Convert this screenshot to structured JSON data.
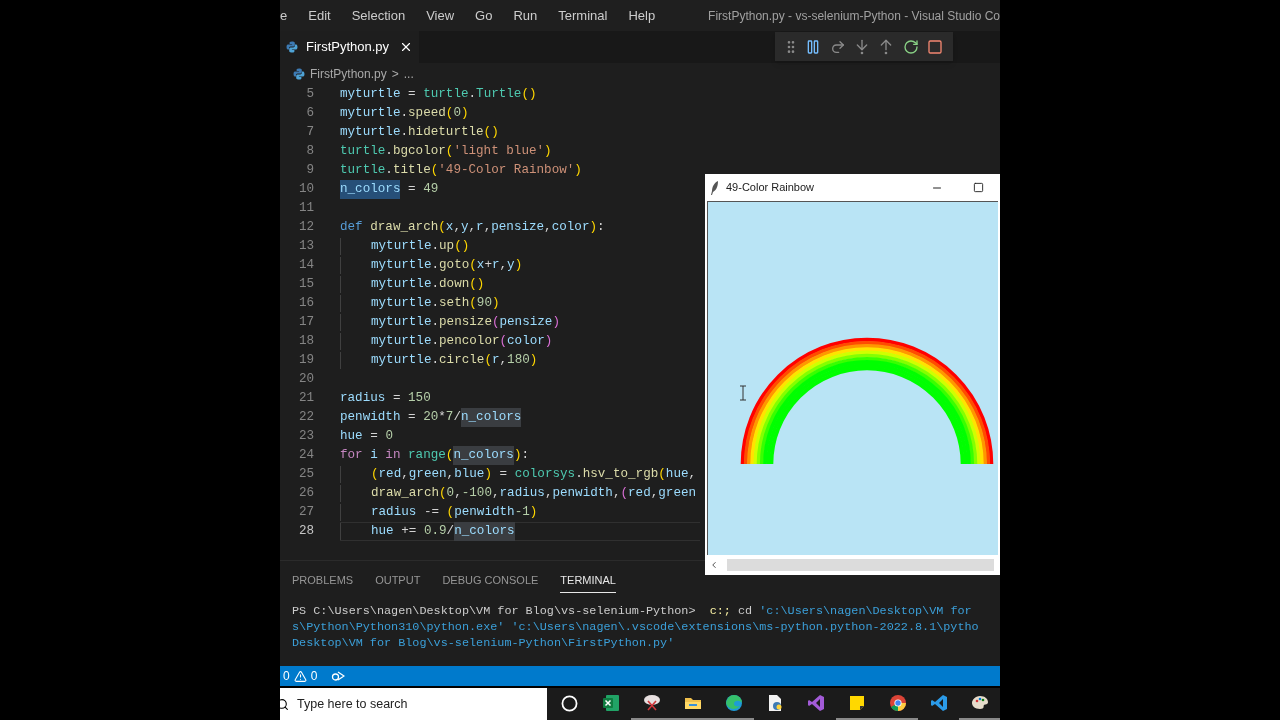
{
  "menu": [
    "e",
    "Edit",
    "Selection",
    "View",
    "Go",
    "Run",
    "Terminal",
    "Help"
  ],
  "window_title": "FirstPython.py - vs-selenium-Python - Visual Studio Co",
  "tabs": [
    {
      "label": "FirstPython.py",
      "selected": true
    }
  ],
  "breadcrumb": {
    "file": "FirstPython.py",
    "separator": ">",
    "more": "..."
  },
  "debug_toolbar": [
    {
      "kind": "grip"
    },
    {
      "kind": "pause"
    },
    {
      "kind": "step_over"
    },
    {
      "kind": "step_into"
    },
    {
      "kind": "step_out"
    },
    {
      "kind": "restart"
    },
    {
      "kind": "stop"
    }
  ],
  "code": {
    "lines": [
      {
        "number": "5",
        "indented": false,
        "current": false,
        "tokens": [
          {
            "kind": "variable",
            "text": "myturtle"
          },
          {
            "kind": "plain",
            "text": " = "
          },
          {
            "kind": "module",
            "text": "turtle"
          },
          {
            "kind": "plain",
            "text": "."
          },
          {
            "kind": "module",
            "text": "Turtle"
          },
          {
            "kind": "bracket",
            "text": "()"
          }
        ]
      },
      {
        "number": "6",
        "indented": false,
        "current": false,
        "tokens": [
          {
            "kind": "variable",
            "text": "myturtle"
          },
          {
            "kind": "plain",
            "text": "."
          },
          {
            "kind": "function",
            "text": "speed"
          },
          {
            "kind": "bracket",
            "text": "("
          },
          {
            "kind": "number",
            "text": "0"
          },
          {
            "kind": "bracket",
            "text": ")"
          }
        ]
      },
      {
        "number": "7",
        "indented": false,
        "current": false,
        "tokens": [
          {
            "kind": "variable",
            "text": "myturtle"
          },
          {
            "kind": "plain",
            "text": "."
          },
          {
            "kind": "function",
            "text": "hideturtle"
          },
          {
            "kind": "bracket",
            "text": "()"
          }
        ]
      },
      {
        "number": "8",
        "indented": false,
        "current": false,
        "tokens": [
          {
            "kind": "module",
            "text": "turtle"
          },
          {
            "kind": "plain",
            "text": "."
          },
          {
            "kind": "function",
            "text": "bgcolor"
          },
          {
            "kind": "bracket",
            "text": "("
          },
          {
            "kind": "string",
            "text": "'light blue'"
          },
          {
            "kind": "bracket",
            "text": ")"
          }
        ]
      },
      {
        "number": "9",
        "indented": false,
        "current": false,
        "tokens": [
          {
            "kind": "module",
            "text": "turtle"
          },
          {
            "kind": "plain",
            "text": "."
          },
          {
            "kind": "function",
            "text": "title"
          },
          {
            "kind": "bracket",
            "text": "("
          },
          {
            "kind": "string",
            "text": "'49-Color Rainbow'"
          },
          {
            "kind": "bracket",
            "text": ")"
          }
        ]
      },
      {
        "number": "10",
        "indented": false,
        "current": false,
        "tokens": [
          {
            "kind": "match_strong",
            "text": "n_colors"
          },
          {
            "kind": "plain",
            "text": " = "
          },
          {
            "kind": "number",
            "text": "49"
          }
        ]
      },
      {
        "number": "11",
        "indented": false,
        "current": false
      },
      {
        "number": "12",
        "indented": false,
        "current": false,
        "tokens": [
          {
            "kind": "keyword",
            "text": "def "
          },
          {
            "kind": "function",
            "text": "draw_arch"
          },
          {
            "kind": "bracket",
            "text": "("
          },
          {
            "kind": "variable",
            "text": "x"
          },
          {
            "kind": "plain",
            "text": ","
          },
          {
            "kind": "variable",
            "text": "y"
          },
          {
            "kind": "plain",
            "text": ","
          },
          {
            "kind": "variable",
            "text": "r"
          },
          {
            "kind": "plain",
            "text": ","
          },
          {
            "kind": "variable",
            "text": "pensize"
          },
          {
            "kind": "plain",
            "text": ","
          },
          {
            "kind": "variable",
            "text": "color"
          },
          {
            "kind": "bracket",
            "text": ")"
          },
          {
            "kind": "plain",
            "text": ":"
          }
        ]
      },
      {
        "number": "13",
        "indented": true,
        "current": false,
        "tokens": [
          {
            "kind": "variable",
            "text": "myturtle"
          },
          {
            "kind": "plain",
            "text": "."
          },
          {
            "kind": "function",
            "text": "up"
          },
          {
            "kind": "bracket",
            "text": "()"
          }
        ]
      },
      {
        "number": "14",
        "indented": true,
        "current": false,
        "tokens": [
          {
            "kind": "variable",
            "text": "myturtle"
          },
          {
            "kind": "plain",
            "text": "."
          },
          {
            "kind": "function",
            "text": "goto"
          },
          {
            "kind": "bracket",
            "text": "("
          },
          {
            "kind": "variable",
            "text": "x"
          },
          {
            "kind": "plain",
            "text": "+"
          },
          {
            "kind": "variable",
            "text": "r"
          },
          {
            "kind": "plain",
            "text": ","
          },
          {
            "kind": "variable",
            "text": "y"
          },
          {
            "kind": "bracket",
            "text": ")"
          }
        ]
      },
      {
        "number": "15",
        "indented": true,
        "current": false,
        "tokens": [
          {
            "kind": "variable",
            "text": "myturtle"
          },
          {
            "kind": "plain",
            "text": "."
          },
          {
            "kind": "function",
            "text": "down"
          },
          {
            "kind": "bracket",
            "text": "()"
          }
        ]
      },
      {
        "number": "16",
        "indented": true,
        "current": false,
        "tokens": [
          {
            "kind": "variable",
            "text": "myturtle"
          },
          {
            "kind": "plain",
            "text": "."
          },
          {
            "kind": "function",
            "text": "seth"
          },
          {
            "kind": "bracket",
            "text": "("
          },
          {
            "kind": "number",
            "text": "90"
          },
          {
            "kind": "bracket",
            "text": ")"
          }
        ]
      },
      {
        "number": "17",
        "indented": true,
        "current": false,
        "tokens": [
          {
            "kind": "variable",
            "text": "myturtle"
          },
          {
            "kind": "plain",
            "text": "."
          },
          {
            "kind": "function",
            "text": "pensize"
          },
          {
            "kind": "bracket2",
            "text": "("
          },
          {
            "kind": "variable",
            "text": "pensize"
          },
          {
            "kind": "bracket2",
            "text": ")"
          }
        ]
      },
      {
        "number": "18",
        "indented": true,
        "current": false,
        "tokens": [
          {
            "kind": "variable",
            "text": "myturtle"
          },
          {
            "kind": "plain",
            "text": "."
          },
          {
            "kind": "function",
            "text": "pencolor"
          },
          {
            "kind": "bracket2",
            "text": "("
          },
          {
            "kind": "variable",
            "text": "color"
          },
          {
            "kind": "bracket2",
            "text": ")"
          }
        ]
      },
      {
        "number": "19",
        "indented": true,
        "current": false,
        "tokens": [
          {
            "kind": "variable",
            "text": "myturtle"
          },
          {
            "kind": "plain",
            "text": "."
          },
          {
            "kind": "function",
            "text": "circle"
          },
          {
            "kind": "bracket",
            "text": "("
          },
          {
            "kind": "variable",
            "text": "r"
          },
          {
            "kind": "plain",
            "text": ","
          },
          {
            "kind": "number",
            "text": "180"
          },
          {
            "kind": "bracket",
            "text": ")"
          }
        ]
      },
      {
        "number": "20",
        "indented": false,
        "current": false
      },
      {
        "number": "21",
        "indented": false,
        "current": false,
        "tokens": [
          {
            "kind": "variable",
            "text": "radius"
          },
          {
            "kind": "plain",
            "text": " = "
          },
          {
            "kind": "number",
            "text": "150"
          }
        ]
      },
      {
        "number": "22",
        "indented": false,
        "current": false,
        "tokens": [
          {
            "kind": "variable",
            "text": "penwidth"
          },
          {
            "kind": "plain",
            "text": " = "
          },
          {
            "kind": "number",
            "text": "20"
          },
          {
            "kind": "plain",
            "text": "*"
          },
          {
            "kind": "number",
            "text": "7"
          },
          {
            "kind": "plain",
            "text": "/"
          },
          {
            "kind": "match",
            "text": "n_colors"
          }
        ]
      },
      {
        "number": "23",
        "indented": false,
        "current": false,
        "tokens": [
          {
            "kind": "variable",
            "text": "hue"
          },
          {
            "kind": "plain",
            "text": " = "
          },
          {
            "kind": "number",
            "text": "0"
          }
        ]
      },
      {
        "number": "24",
        "indented": false,
        "current": false,
        "tokens": [
          {
            "kind": "control",
            "text": "for "
          },
          {
            "kind": "variable",
            "text": "i "
          },
          {
            "kind": "control",
            "text": "in "
          },
          {
            "kind": "module",
            "text": "range"
          },
          {
            "kind": "bracket",
            "text": "("
          },
          {
            "kind": "match",
            "text": "n_colors"
          },
          {
            "kind": "bracket",
            "text": ")"
          },
          {
            "kind": "plain",
            "text": ":"
          }
        ]
      },
      {
        "number": "25",
        "indented": true,
        "current": false,
        "tokens": [
          {
            "kind": "bracket",
            "text": "("
          },
          {
            "kind": "variable",
            "text": "red"
          },
          {
            "kind": "plain",
            "text": ","
          },
          {
            "kind": "variable",
            "text": "green"
          },
          {
            "kind": "plain",
            "text": ","
          },
          {
            "kind": "variable",
            "text": "blue"
          },
          {
            "kind": "bracket",
            "text": ")"
          },
          {
            "kind": "plain",
            "text": " = "
          },
          {
            "kind": "module",
            "text": "colorsys"
          },
          {
            "kind": "plain",
            "text": "."
          },
          {
            "kind": "function",
            "text": "hsv_to_rgb"
          },
          {
            "kind": "bracket",
            "text": "("
          },
          {
            "kind": "variable",
            "text": "hue"
          },
          {
            "kind": "plain",
            "text": ","
          }
        ]
      },
      {
        "number": "26",
        "indented": true,
        "current": false,
        "tokens": [
          {
            "kind": "function",
            "text": "draw_arch"
          },
          {
            "kind": "bracket",
            "text": "("
          },
          {
            "kind": "number",
            "text": "0"
          },
          {
            "kind": "plain",
            "text": ","
          },
          {
            "kind": "number",
            "text": "-100"
          },
          {
            "kind": "plain",
            "text": ","
          },
          {
            "kind": "variable",
            "text": "radius"
          },
          {
            "kind": "plain",
            "text": ","
          },
          {
            "kind": "variable",
            "text": "penwidth"
          },
          {
            "kind": "plain",
            "text": ","
          },
          {
            "kind": "bracket2",
            "text": "("
          },
          {
            "kind": "variable",
            "text": "red"
          },
          {
            "kind": "plain",
            "text": ","
          },
          {
            "kind": "variable",
            "text": "green"
          }
        ]
      },
      {
        "number": "27",
        "indented": true,
        "current": false,
        "tokens": [
          {
            "kind": "variable",
            "text": "radius"
          },
          {
            "kind": "plain",
            "text": " -= "
          },
          {
            "kind": "bracket",
            "text": "("
          },
          {
            "kind": "variable",
            "text": "penwidth"
          },
          {
            "kind": "number",
            "text": "-1"
          },
          {
            "kind": "bracket",
            "text": ")"
          }
        ]
      },
      {
        "number": "28",
        "indented": true,
        "current": true,
        "tokens": [
          {
            "kind": "variable",
            "text": "hue"
          },
          {
            "kind": "plain",
            "text": " += "
          },
          {
            "kind": "number",
            "text": "0.9"
          },
          {
            "kind": "plain",
            "text": "/"
          },
          {
            "kind": "match",
            "text": "n_colors"
          }
        ]
      }
    ]
  },
  "turtle_window": {
    "title": "49-Color Rainbow"
  },
  "panel_tabs": [
    {
      "label": "PROBLEMS",
      "selected": false
    },
    {
      "label": "OUTPUT",
      "selected": false
    },
    {
      "label": "DEBUG CONSOLE",
      "selected": false
    },
    {
      "label": "TERMINAL",
      "selected": true
    }
  ],
  "terminal": [
    [
      {
        "kind": "prompt",
        "text": "PS C:\\Users\\nagen\\Desktop\\VM for Blog\\vs-selenium-Python> "
      },
      {
        "kind": "command",
        "text": " c:;"
      },
      {
        "kind": "prompt",
        "text": " cd "
      },
      {
        "kind": "string",
        "text": "'c:\\Users\\nagen\\Desktop\\VM for"
      }
    ],
    [
      {
        "kind": "string",
        "text": "s\\Python\\Python310\\python.exe' 'c:\\Users\\nagen\\.vscode\\extensions\\ms-python.python-2022.8.1\\pytho"
      }
    ],
    [
      {
        "kind": "string",
        "text": "Desktop\\VM for Blog\\vs-selenium-Python\\FirstPython.py'"
      }
    ]
  ],
  "status_bar": {
    "errors": "0",
    "warnings": "0"
  },
  "taskbar": {
    "search_placeholder": "Type here to search",
    "apps": [
      {
        "kind": "cortana",
        "running": false
      },
      {
        "kind": "excel",
        "running": false
      },
      {
        "kind": "snip",
        "running": true
      },
      {
        "kind": "folder",
        "running": true
      },
      {
        "kind": "edge",
        "running": true
      },
      {
        "kind": "python_file",
        "running": false
      },
      {
        "kind": "visual_studio",
        "running": false
      },
      {
        "kind": "sticky_notes",
        "running": true
      },
      {
        "kind": "chrome",
        "running": true
      },
      {
        "kind": "vscode",
        "running": false
      },
      {
        "kind": "paint",
        "running": true
      }
    ]
  }
}
